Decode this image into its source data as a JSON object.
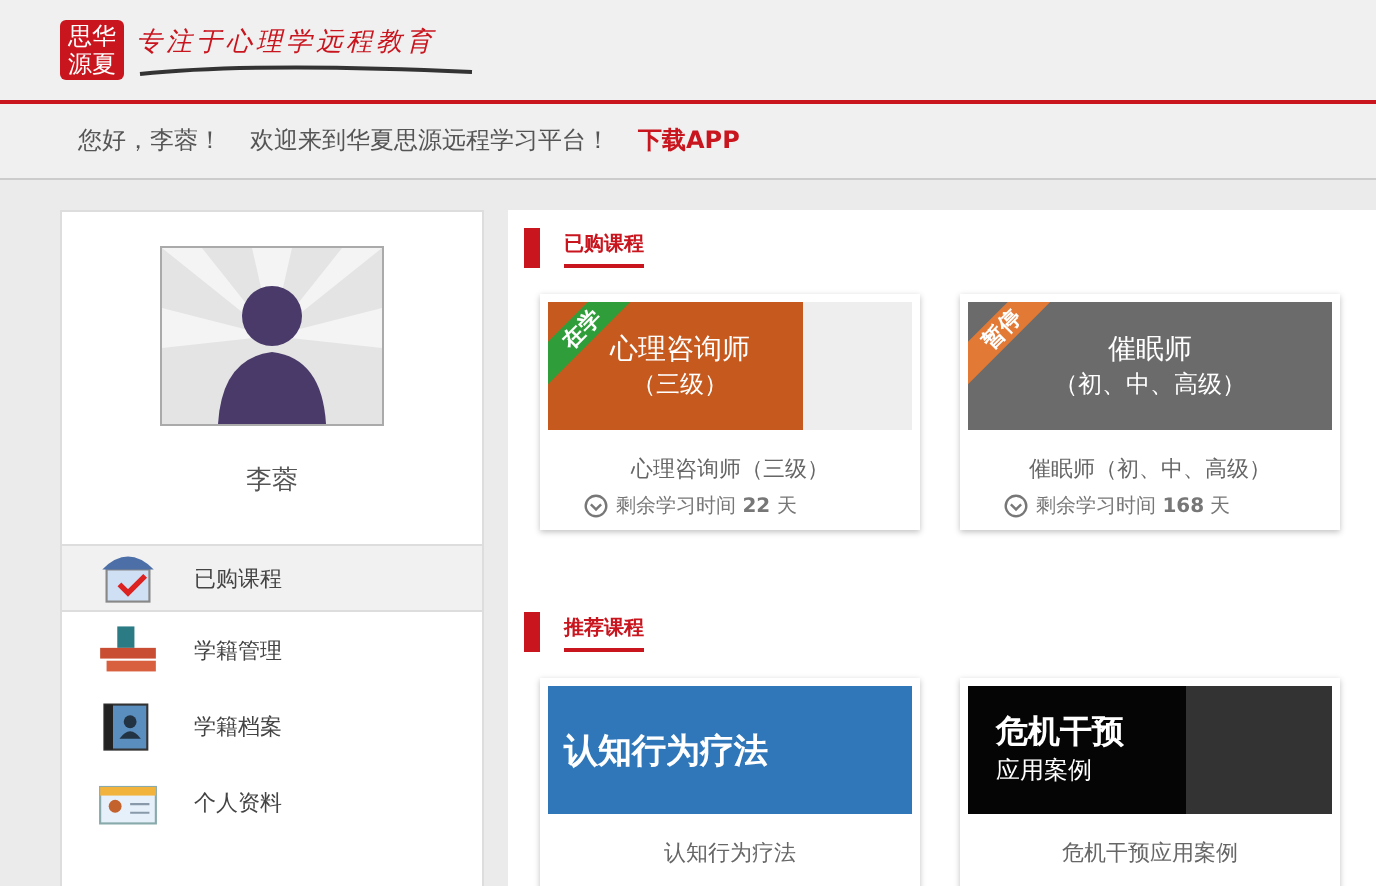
{
  "header": {
    "logo_text": "思华源夏",
    "slogan": "专注于心理学远程教育"
  },
  "welcome": {
    "greeting": "您好，李蓉！",
    "message": "欢迎来到华夏思源远程学习平台！",
    "app_link": "下载APP"
  },
  "sidebar": {
    "user_name": "李蓉",
    "items": [
      {
        "label": "已购课程",
        "kind": "shop",
        "selected": true
      },
      {
        "label": "学籍管理",
        "kind": "folders",
        "selected": false
      },
      {
        "label": "学籍档案",
        "kind": "contacts",
        "selected": false
      },
      {
        "label": "个人资料",
        "kind": "idcard",
        "selected": false
      }
    ]
  },
  "purchased": {
    "title": "已购课程",
    "courses": [
      {
        "banner_title": "心理咨询师",
        "banner_subtitle": "（三级）",
        "status": {
          "kind": "studying",
          "label": "在学"
        },
        "name": "心理咨询师（三级）",
        "remaining_label": "剩余学习时间",
        "remaining_days": "22",
        "unit": "天",
        "kind": "orange"
      },
      {
        "banner_title": "催眠师",
        "banner_subtitle": "（初、中、高级）",
        "status": {
          "kind": "paused",
          "label": "暂停"
        },
        "name": "催眠师（初、中、高级）",
        "remaining_label": "剩余学习时间",
        "remaining_days": "168",
        "unit": "天",
        "kind": "grey"
      }
    ]
  },
  "recommended": {
    "title": "推荐课程",
    "courses": [
      {
        "banner_title": "认知行为疗法",
        "name": "认知行为疗法",
        "kind": "blue"
      },
      {
        "banner_title": "危机干预",
        "banner_subtitle": "应用案例",
        "name": "危机干预应用案例",
        "kind": "black"
      }
    ]
  }
}
